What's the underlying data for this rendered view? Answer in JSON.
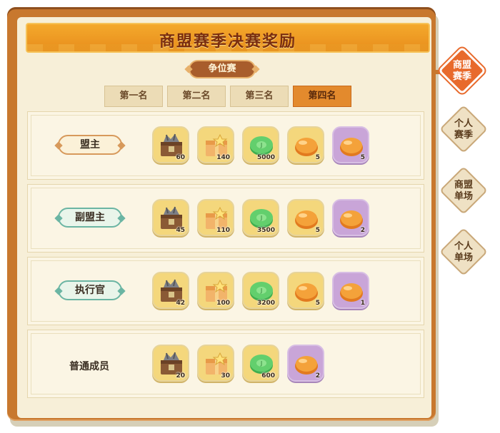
{
  "title": "商盟赛季决赛奖励",
  "subtitle": "争位赛",
  "tabs": [
    "第一名",
    "第二名",
    "第三名",
    "第四名"
  ],
  "active_tab_index": 3,
  "side_tabs": [
    {
      "line1": "商盟",
      "line2": "赛季",
      "active": true
    },
    {
      "line1": "个人",
      "line2": "赛季",
      "active": false
    },
    {
      "line1": "商盟",
      "line2": "单场",
      "active": false
    },
    {
      "line1": "个人",
      "line2": "单场",
      "active": false
    }
  ],
  "rows": [
    {
      "role": "盟主",
      "badge": "gold",
      "rewards": [
        {
          "icon": "treasure-chest-icon",
          "qty": "60"
        },
        {
          "icon": "gift-box-icon",
          "qty": "140"
        },
        {
          "icon": "jade-coin-icon",
          "qty": "5000"
        },
        {
          "icon": "orange-gem-icon",
          "qty": "5"
        },
        {
          "icon": "orange-gem-purple-icon",
          "qty": "5"
        }
      ]
    },
    {
      "role": "副盟主",
      "badge": "teal",
      "rewards": [
        {
          "icon": "treasure-chest-icon",
          "qty": "45"
        },
        {
          "icon": "gift-box-icon",
          "qty": "110"
        },
        {
          "icon": "jade-coin-icon",
          "qty": "3500"
        },
        {
          "icon": "orange-gem-icon",
          "qty": "5"
        },
        {
          "icon": "orange-gem-purple-icon",
          "qty": "2"
        }
      ]
    },
    {
      "role": "执行官",
      "badge": "teal",
      "rewards": [
        {
          "icon": "treasure-chest-icon",
          "qty": "42"
        },
        {
          "icon": "gift-box-icon",
          "qty": "100"
        },
        {
          "icon": "jade-coin-icon",
          "qty": "3200"
        },
        {
          "icon": "orange-gem-icon",
          "qty": "5"
        },
        {
          "icon": "orange-gem-purple-icon",
          "qty": "1"
        }
      ]
    },
    {
      "role": "普通成员",
      "badge": "none",
      "rewards": [
        {
          "icon": "treasure-chest-icon",
          "qty": "20"
        },
        {
          "icon": "gift-box-icon",
          "qty": "30"
        },
        {
          "icon": "jade-coin-icon",
          "qty": "600"
        },
        {
          "icon": "orange-gem-purple-icon",
          "qty": "2"
        }
      ]
    }
  ],
  "colors": {
    "accent": "#e86a2c",
    "banner": "#f4a92c",
    "frame": "#c8782e",
    "paper": "#f7efd8"
  }
}
